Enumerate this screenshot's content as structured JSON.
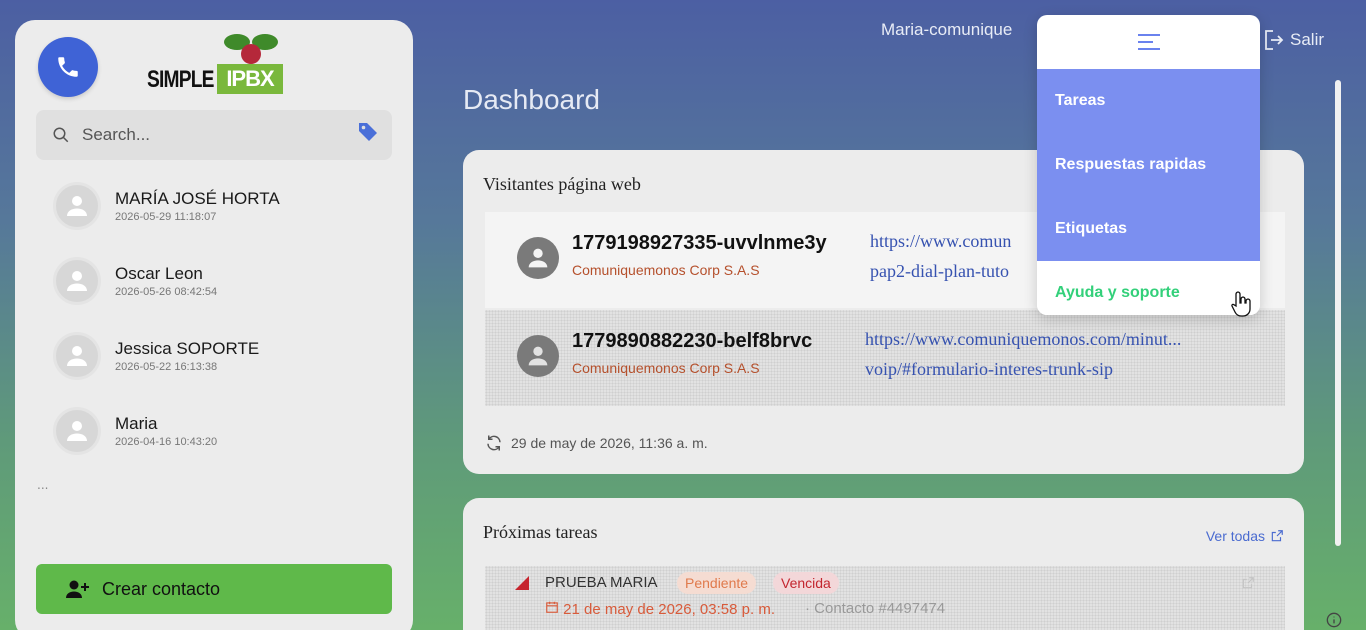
{
  "sidebar": {
    "logo": {
      "word": "SIMPLE",
      "box": "IPBX"
    },
    "search": {
      "placeholder": "Search..."
    },
    "contacts": [
      {
        "name": "MARÍA JOSÉ HORTA",
        "date": "2026-05-29 11:18:07"
      },
      {
        "name": "Oscar Leon",
        "date": "2026-05-26 08:42:54"
      },
      {
        "name": "Jessica SOPORTE",
        "date": "2026-05-22 16:13:38"
      },
      {
        "name": "Maria",
        "date": "2026-04-16 10:43:20"
      }
    ],
    "more": "...",
    "create_label": "Crear contacto"
  },
  "header": {
    "user": "Maria-comunique",
    "logout_label": "Salir"
  },
  "main": {
    "title": "Dashboard",
    "visitors": {
      "title": "Visitantes página web",
      "rows": [
        {
          "id": "1779198927335-uvvlnme3y",
          "company": "Comuniquemonos Corp S.A.S",
          "url1": "https://www.comun",
          "url2": "pap2-dial-plan-tuto"
        },
        {
          "id": "1779890882230-belf8brvc",
          "company": "Comuniquemonos Corp S.A.S",
          "url1": "https://www.comuniquemonos.com/minut...",
          "url2": "voip/#formulario-interes-trunk-sip"
        }
      ],
      "updated": "29 de may de 2026, 11:36 a. m."
    },
    "tasks": {
      "title": "Próximas tareas",
      "see_all": "Ver todas",
      "items": [
        {
          "name": "PRUEBA MARIA",
          "status": "Pendiente",
          "overdue": "Vencida",
          "date": "21 de may de 2026, 03:58 p. m.",
          "contact": "· Contacto #4497474"
        }
      ]
    }
  },
  "dropdown": {
    "items": [
      "Tareas",
      "Respuestas rapidas",
      "Etiquetas",
      "Ayuda y soporte"
    ]
  },
  "colors": {
    "accent": "#3f63d6",
    "menu_blue": "#7b8ff0",
    "green": "#5fb94a",
    "link": "#3652b0",
    "overdue": "#c3262f"
  }
}
